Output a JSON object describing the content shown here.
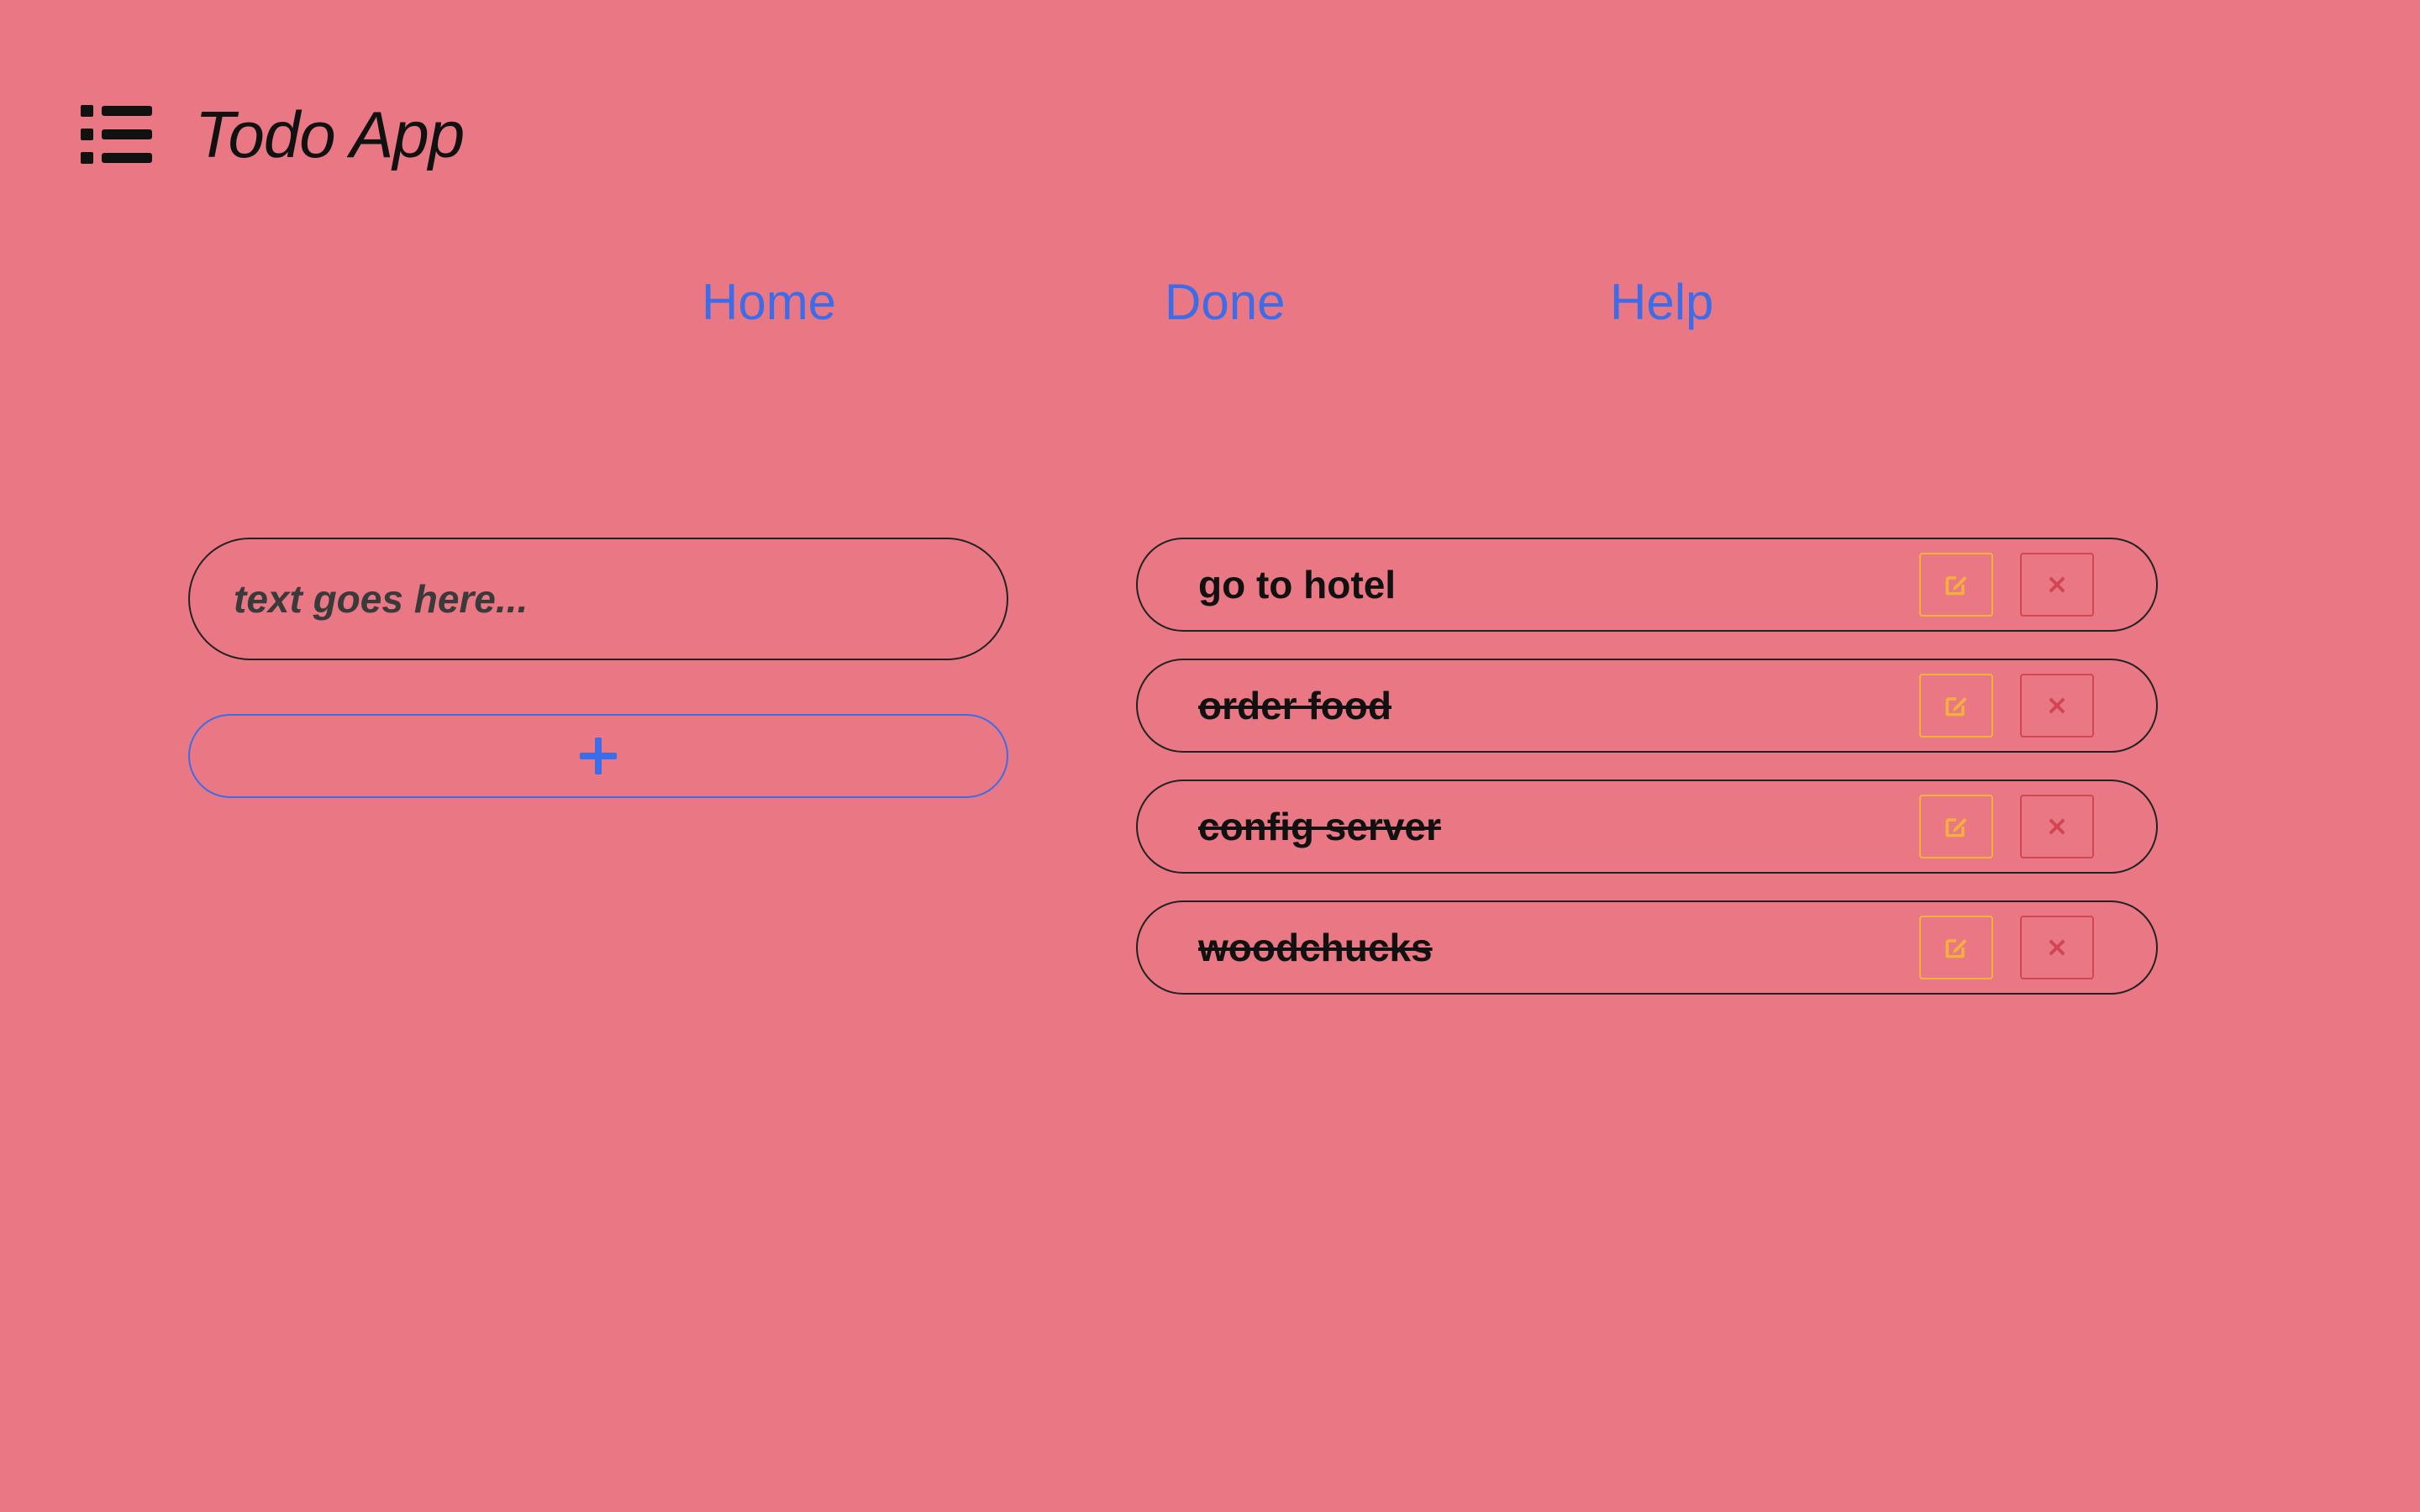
{
  "header": {
    "icon": "list-icon",
    "title": "Todo App"
  },
  "nav": {
    "home": "Home",
    "done": "Done",
    "help": "Help"
  },
  "form": {
    "input_value": "",
    "input_placeholder": "text goes here...",
    "add_button_icon": "plus-icon"
  },
  "todos": [
    {
      "text": "go to hotel",
      "done": false
    },
    {
      "text": "order food",
      "done": true
    },
    {
      "text": "config server",
      "done": true
    },
    {
      "text": "woodchucks",
      "done": true
    }
  ],
  "item_actions": {
    "edit_icon": "edit-icon",
    "delete_icon": "close-icon"
  },
  "colors": {
    "background": "#e97884",
    "link": "#3d6ce8",
    "edit": "#f2b23a",
    "delete": "#d04653",
    "text": "#111111"
  }
}
